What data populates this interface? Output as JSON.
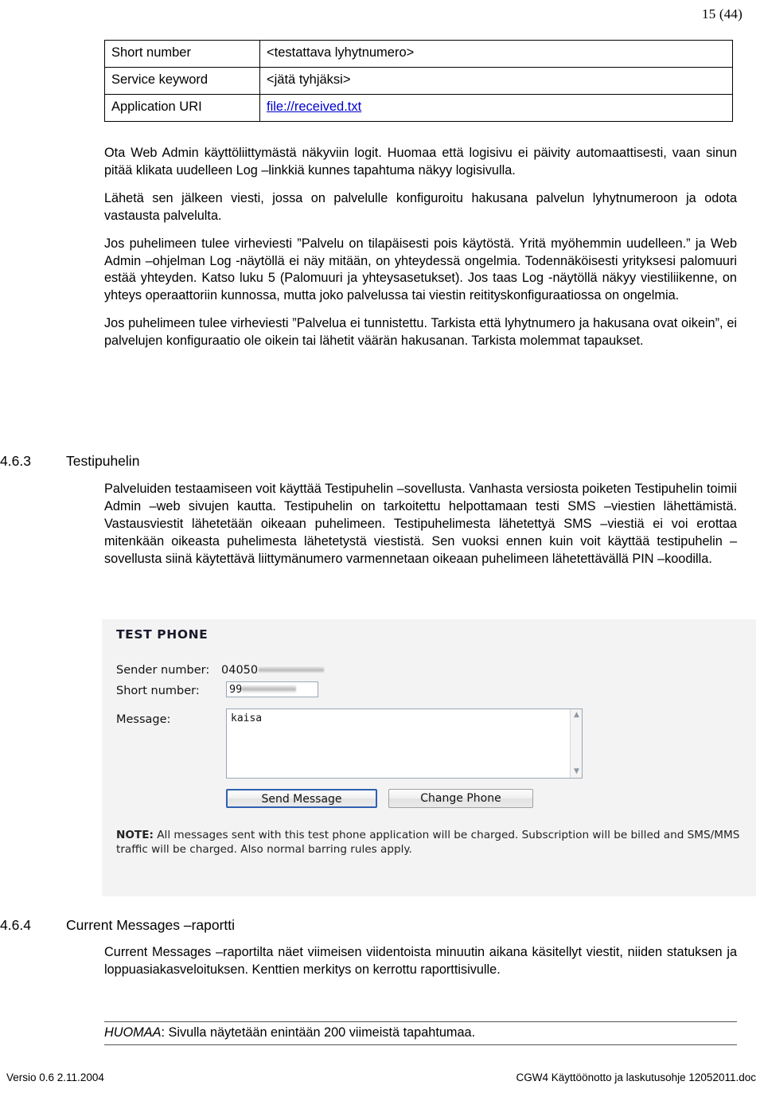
{
  "header": {
    "page_number": "15 (44)"
  },
  "param_table": {
    "rows": [
      {
        "key": "Short number",
        "value": "<testattava lyhytnumero>",
        "is_link": false
      },
      {
        "key": "Service keyword",
        "value": "<jätä tyhjäksi>",
        "is_link": false
      },
      {
        "key": "Application URI",
        "value": "file://received.txt",
        "is_link": true
      }
    ]
  },
  "body": {
    "paragraphs": [
      "Ota Web Admin käyttöliittymästä näkyviin logit. Huomaa että logisivu ei päivity automaattisesti, vaan sinun pitää klikata uudelleen Log –linkkiä kunnes tapahtuma näkyy logisivulla.",
      "Lähetä sen jälkeen viesti, jossa on palvelulle konfiguroitu hakusana palvelun lyhytnumeroon ja odota vastausta palvelulta.",
      "Jos puhelimeen tulee virheviesti ”Palvelu on tilapäisesti pois käytöstä. Yritä myöhemmin uudelleen.” ja Web Admin –ohjelman Log -näytöllä ei näy mitään, on yhteydessä ongelmia. Todennäköisesti yrityksesi palomuuri estää yhteyden. Katso luku 5 (Palomuuri ja yhteysasetukset). Jos taas Log -näytöllä näkyy viestiliikenne,  on yhteys operaattoriin kunnossa, mutta joko palvelussa tai viestin reitityskonfiguraatiossa on ongelmia.",
      "Jos puhelimeen tulee virheviesti ”Palvelua ei tunnistettu. Tarkista että lyhytnumero ja hakusana ovat oikein”, ei palvelujen konfiguraatio ole oikein tai lähetit väärän hakusanan. Tarkista molemmat tapaukset."
    ]
  },
  "section_463": {
    "number": "4.6.3",
    "title": "Testipuhelin",
    "paragraph": "Palveluiden testaamiseen voit käyttää Testipuhelin –sovellusta. Vanhasta versiosta poiketen Testipuhelin toimii Admin –web sivujen kautta. Testipuhelin on tarkoitettu helpottamaan testi SMS –viestien lähettämistä. Vastausviestit lähetetään oikeaan puhelimeen. Testipuhelimesta lähetettyä SMS –viestiä ei voi erottaa mitenkään oikeasta puhelimesta lähetetystä viestistä. Sen vuoksi ennen kuin voit käyttää testipuhelin –sovellusta siinä käytettävä liittymänumero varmennetaan oikeaan puhelimeen lähetettävällä PIN –koodilla."
  },
  "test_phone": {
    "title": "TEST PHONE",
    "sender_label": "Sender number:",
    "sender_value": "04050",
    "short_label": "Short number:",
    "short_value": "99",
    "message_label": "Message:",
    "message_value": "kaisa",
    "send_button": "Send Message",
    "change_button": "Change Phone",
    "note_prefix": "NOTE:",
    "note_text": " All messages sent with this test phone application will be charged. Subscription will be billed and SMS/MMS traffic will be charged. Also normal barring rules apply.",
    "scroll_up_icon": "▲",
    "scroll_down_icon": "▼",
    "focus_color": "#2f5fb0"
  },
  "section_464": {
    "number": "4.6.4",
    "title": "Current Messages –raportti",
    "paragraph": "Current Messages –raportilta näet viimeisen viidentoista minuutin aikana käsitellyt viestit, niiden statuksen ja  loppuasiakasveloituksen. Kenttien merkitys on kerrottu raporttisivulle."
  },
  "callout": {
    "tag": "HUOMAA",
    "text": ": Sivulla näytetään enintään 200 viimeistä tapahtumaa."
  },
  "footer": {
    "left": "Versio 0.6 2.11.2004",
    "right": "CGW4 Käyttöönotto ja laskutusohje 12052011.doc"
  }
}
